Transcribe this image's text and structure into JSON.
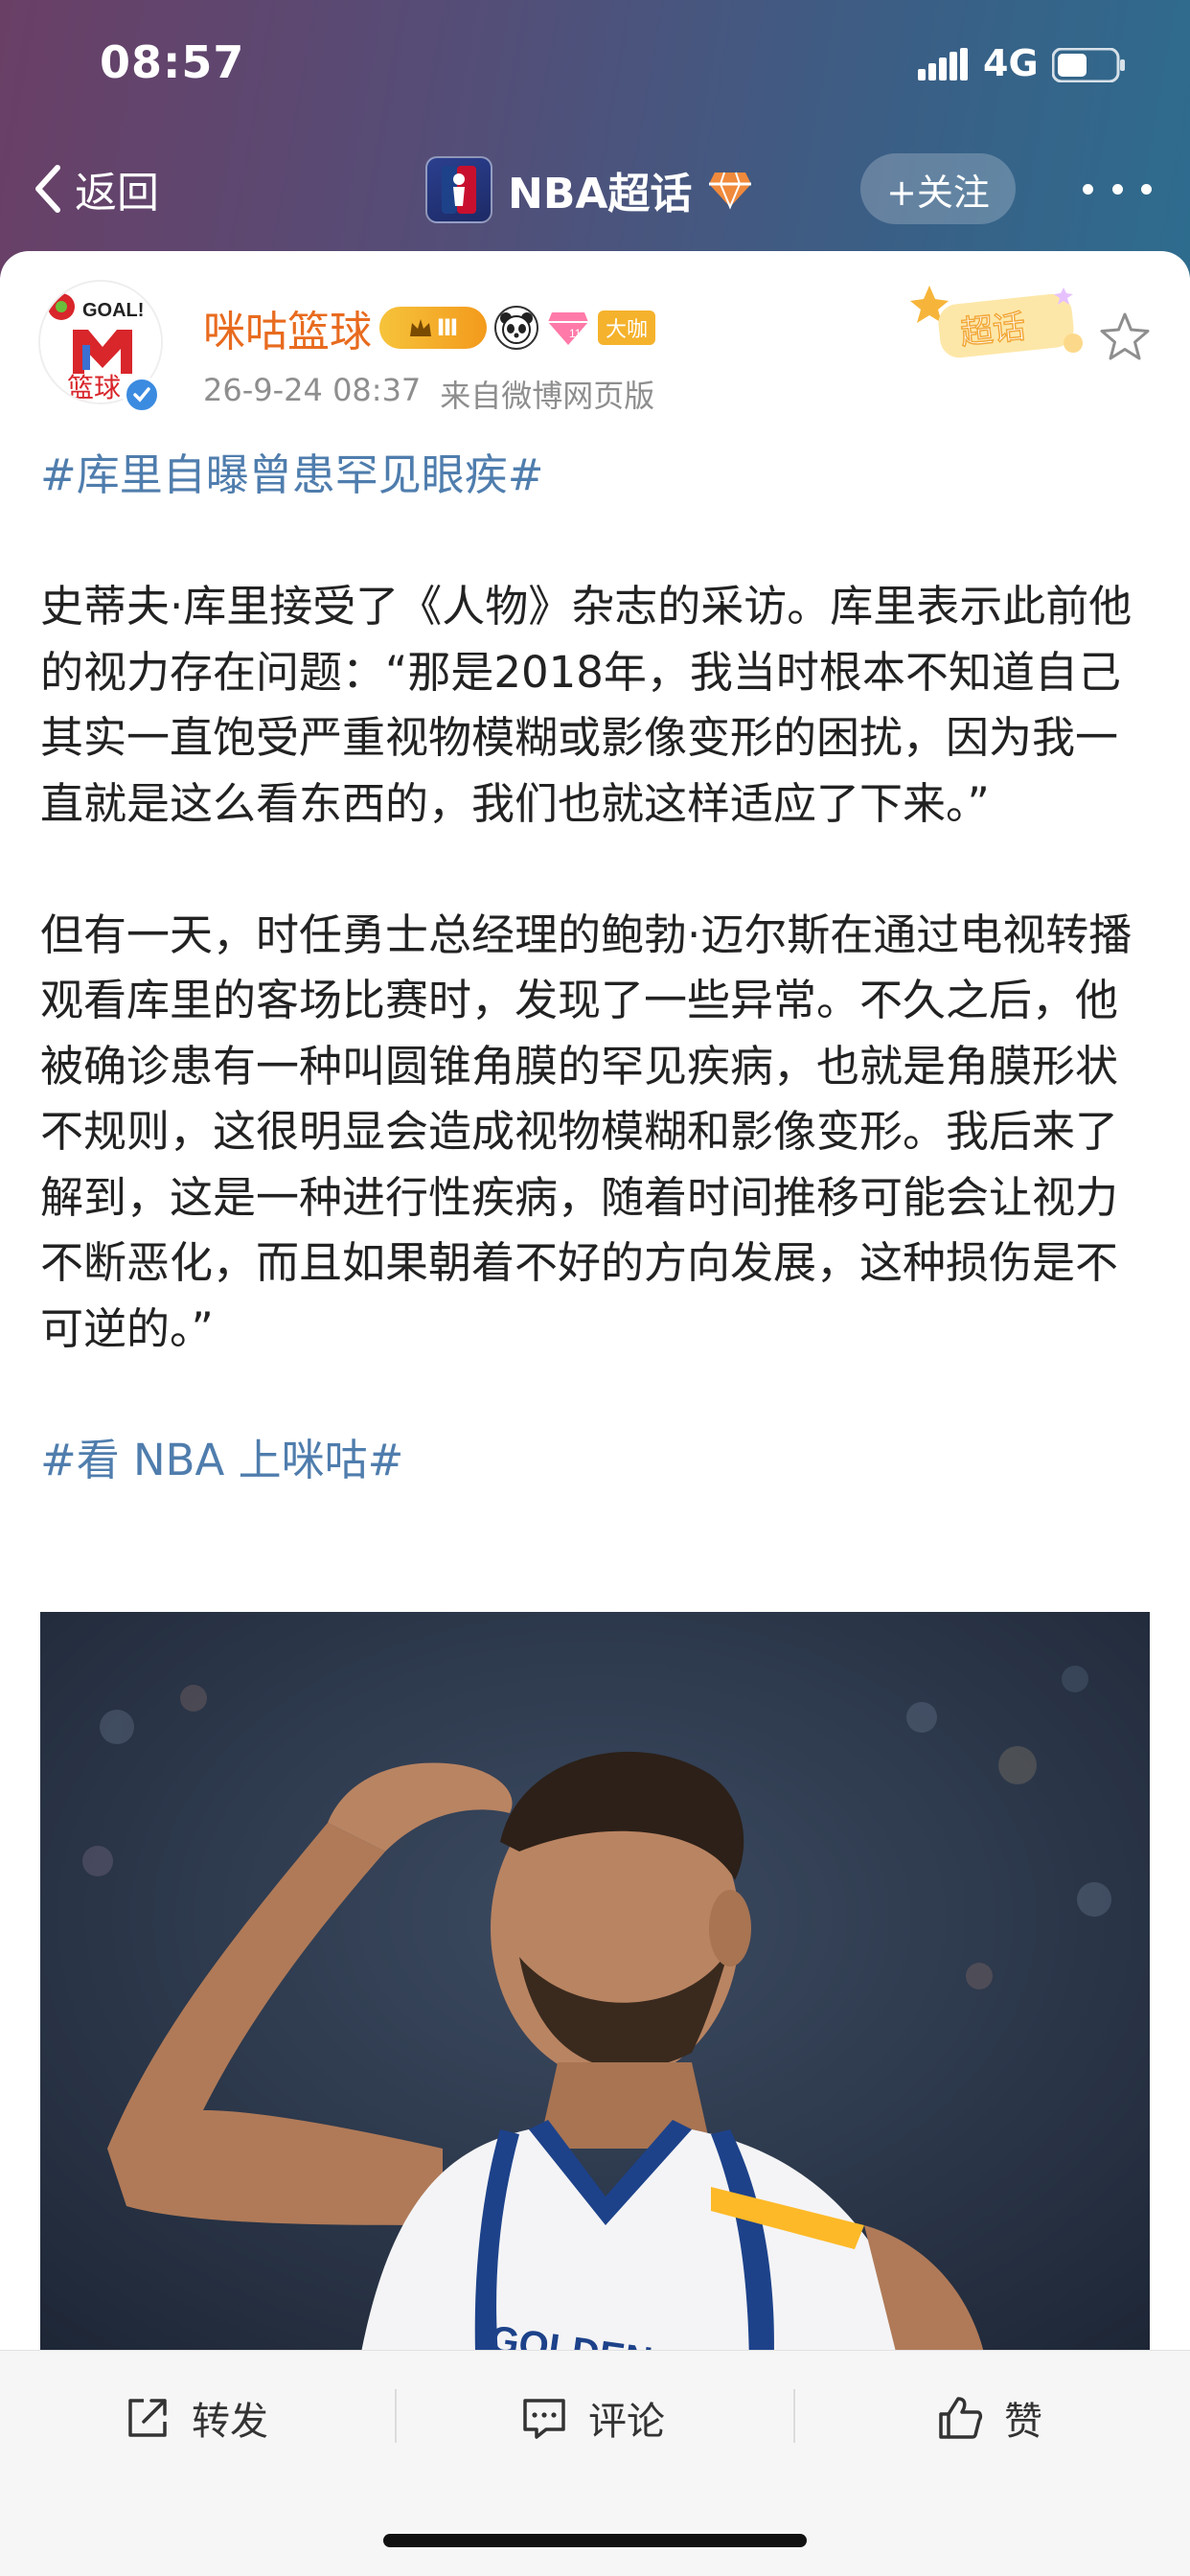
{
  "status_bar": {
    "time": "08:57",
    "network": "4G"
  },
  "nav": {
    "back_label": "返回",
    "topic_title": "NBA超话",
    "follow_label": "+关注",
    "more_icon": "more-dots-icon"
  },
  "post": {
    "author": {
      "name": "咪咕篮球",
      "avatar_text_top": "GOAL!",
      "avatar_text_bottom": "篮球",
      "rank_badge": "Ⅲ",
      "big_badge": "大咖"
    },
    "date": "26-9-24 08:37",
    "source": "来自微博网页版",
    "super_badge": "超话",
    "lines_title": "#库里自曝曾患罕见眼疾#",
    "paragraph1": "史蒂夫·库里接受了《人物》杂志的采访。库里表示此前他的视力存在问题：“那是2018年，我当时根本不知道自己其实一直饱受严重视物模糊或影像变形的困扰，因为我一直就是这么看东西的，我们也就这样适应了下来。”",
    "paragraph2": "但有一天，时任勇士总经理的鲍勃·迈尔斯在通过电视转播观看库里的客场比赛时，发现了一些异常。不久之后，他被确诊患有一种叫圆锥角膜的罕见疾病，也就是角膜形状不规则，这很明显会造成视物模糊和影像变形。我后来了解到，这是一种进行性疾病，随着时间推移可能会让视力不断恶化，而且如果朝着不好的方向发展，这种损伤是不可逆的。”",
    "hashtag_bottom": "#看 NBA 上咪咕#",
    "image_jersey_text": "GOLDEN STATE"
  },
  "actions": {
    "repost": "转发",
    "comment": "评论",
    "like": "赞"
  },
  "colors": {
    "hashtag": "#4f7dad",
    "author": "#e86b1f",
    "meta": "#8e8e8e"
  }
}
